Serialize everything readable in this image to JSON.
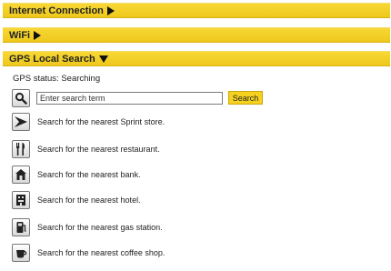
{
  "sections": {
    "internet": {
      "title": "Internet Connection",
      "expanded": false
    },
    "wifi": {
      "title": "WiFi",
      "expanded": false
    },
    "gps": {
      "title": "GPS Local Search",
      "expanded": true
    }
  },
  "gps": {
    "status_text": "GPS status: Searching",
    "search": {
      "placeholder": "Enter search term",
      "value": "",
      "button_label": "Search"
    },
    "items": [
      {
        "icon": "sprint-logo-icon",
        "label": "Search for the nearest Sprint store."
      },
      {
        "icon": "fork-knife-icon",
        "label": "Search for the nearest restaurant."
      },
      {
        "icon": "bank-icon",
        "label": "Search for the nearest bank."
      },
      {
        "icon": "hotel-icon",
        "label": "Search for the nearest hotel."
      },
      {
        "icon": "gas-pump-icon",
        "label": "Search for the nearest gas station."
      },
      {
        "icon": "coffee-cup-icon",
        "label": "Search for the nearest coffee shop."
      }
    ]
  },
  "colors": {
    "header_yellow": "#f2cf28",
    "button_yellow": "#f6d21f"
  }
}
